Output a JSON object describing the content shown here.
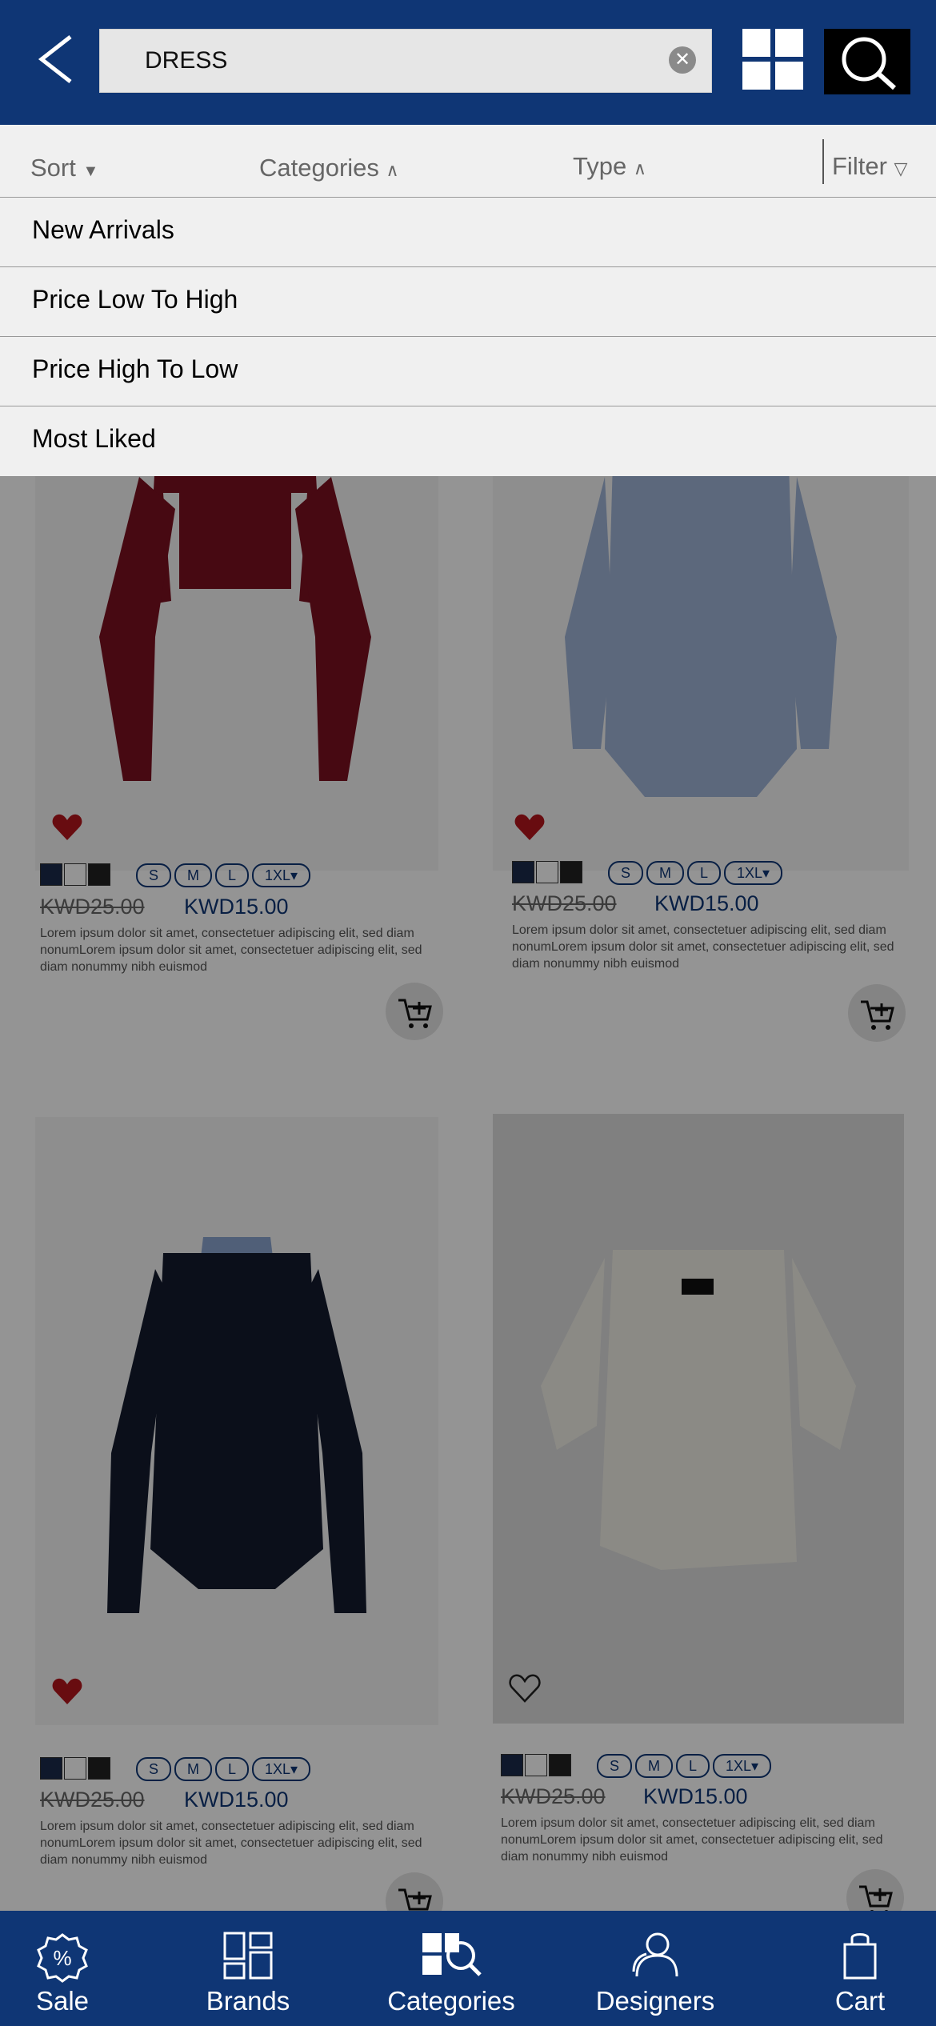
{
  "header": {
    "search_value": "DRESS",
    "icons": [
      "back-arrow-icon",
      "clear-icon",
      "grid-view-icon",
      "search-icon"
    ]
  },
  "sortbar": {
    "sort": "Sort",
    "categories": "Categories",
    "type": "Type",
    "filter": "Filter"
  },
  "sort_menu": {
    "items": [
      {
        "label": "New Arrivals"
      },
      {
        "label": "Price Low To High"
      },
      {
        "label": "Price High To Low"
      },
      {
        "label": "Most Liked"
      }
    ]
  },
  "products": [
    {
      "old_price": "KWD25.00",
      "new_price": "KWD15.00",
      "liked": true,
      "sizes": [
        "S",
        "M",
        "L",
        "1XL"
      ],
      "description": "Lorem ipsum dolor sit amet, consectetuer adipiscing elit, sed diam nonumLorem ipsum dolor sit amet, consectetuer adipiscing elit, sed diam nonummy nibh euismod"
    },
    {
      "old_price": "KWD25.00",
      "new_price": "KWD15.00",
      "liked": true,
      "sizes": [
        "S",
        "M",
        "L",
        "1XL"
      ],
      "description": "Lorem ipsum dolor sit amet, consectetuer adipiscing elit, sed diam nonumLorem ipsum dolor sit amet, consectetuer adipiscing elit, sed diam nonummy nibh euismod"
    },
    {
      "old_price": "KWD25.00",
      "new_price": "KWD15.00",
      "liked": true,
      "sizes": [
        "S",
        "M",
        "L",
        "1XL"
      ],
      "description": "Lorem ipsum dolor sit amet, consectetuer adipiscing elit, sed diam nonumLorem ipsum dolor sit amet, consectetuer adipiscing elit, sed diam nonummy nibh euismod"
    },
    {
      "old_price": "KWD25.00",
      "new_price": "KWD15.00",
      "liked": false,
      "sizes": [
        "S",
        "M",
        "L",
        "1XL"
      ],
      "description": "Lorem ipsum dolor sit amet, consectetuer adipiscing elit, sed diam nonumLorem ipsum dolor sit amet, consectetuer adipiscing elit, sed diam nonummy nibh euismod"
    }
  ],
  "swatch_colors": [
    "#1b2a4a",
    "#ffffff",
    "#222222"
  ],
  "colors": {
    "brand": "#0f3675",
    "heart": "#b3161c"
  },
  "bottom_nav": [
    {
      "label": "Sale",
      "icon": "sale-badge-icon"
    },
    {
      "label": "Brands",
      "icon": "brands-icon"
    },
    {
      "label": "Categories",
      "icon": "categories-icon"
    },
    {
      "label": "Designers",
      "icon": "designers-icon"
    },
    {
      "label": "Cart",
      "icon": "cart-icon"
    }
  ]
}
